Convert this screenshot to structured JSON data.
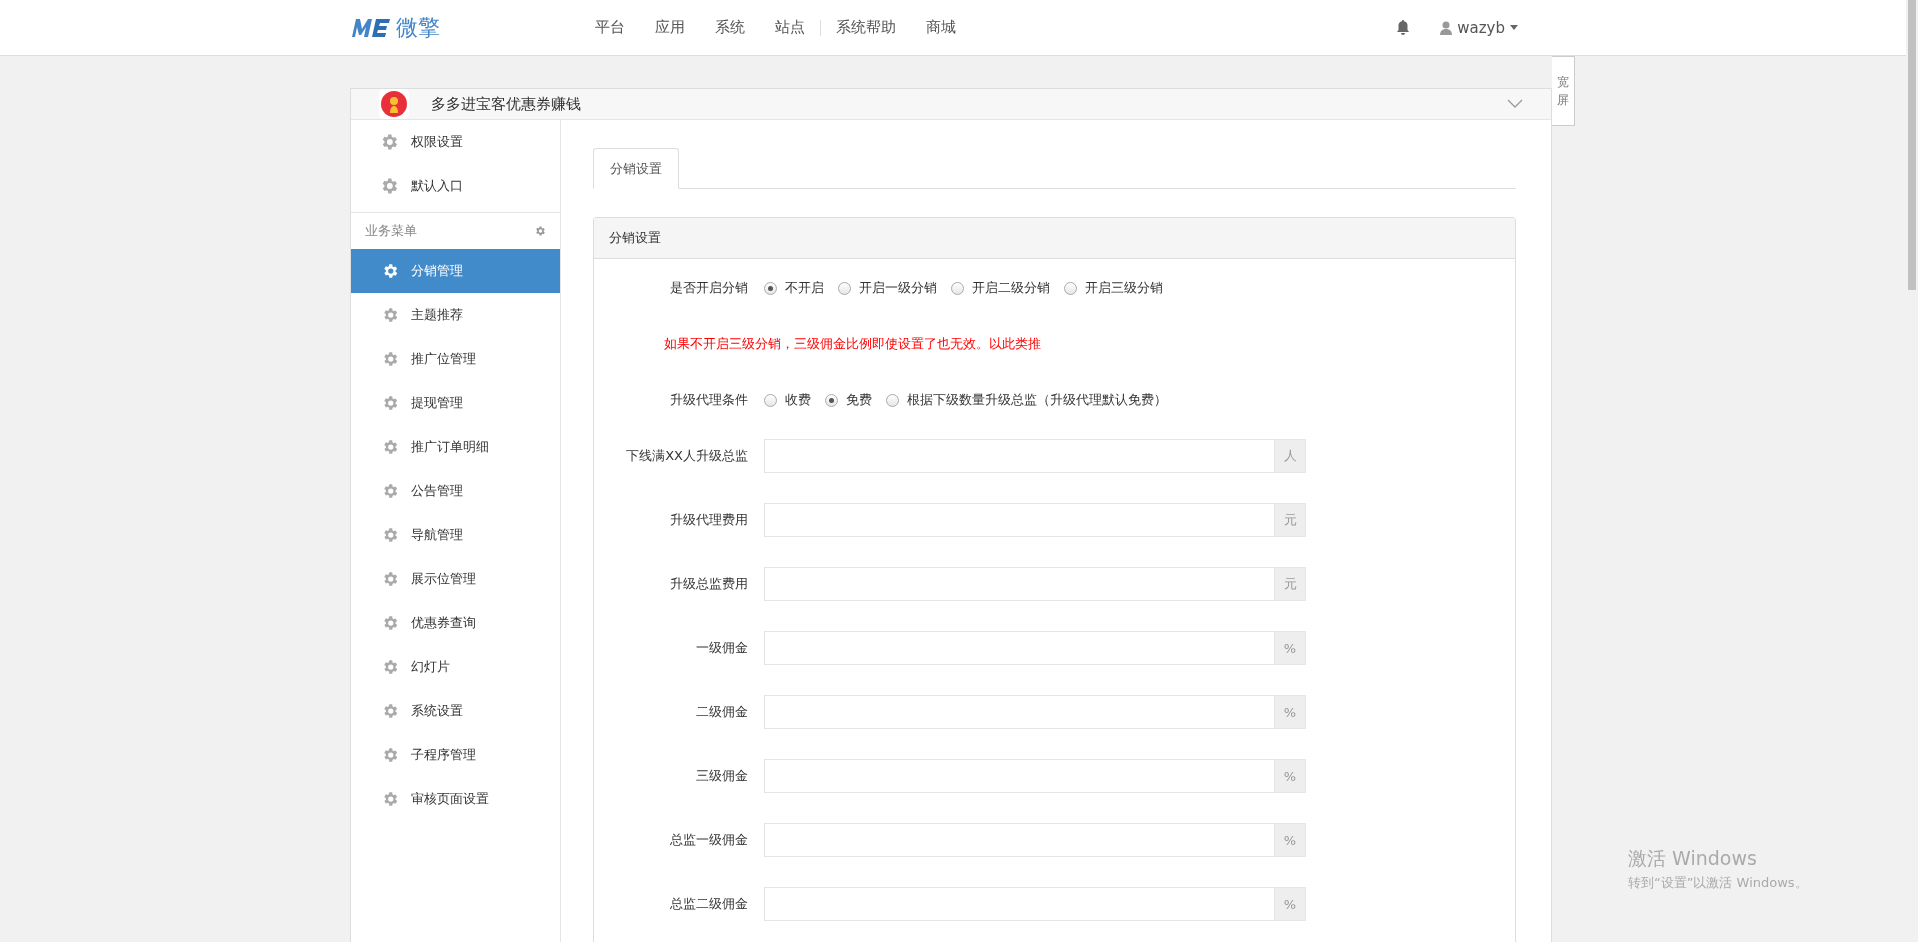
{
  "header": {
    "logo_text": "微擎",
    "nav": [
      {
        "label": "平台"
      },
      {
        "label": "应用"
      },
      {
        "label": "系统"
      },
      {
        "label": "站点"
      },
      {
        "label": "系统帮助",
        "divider_before": true
      },
      {
        "label": "商城"
      }
    ],
    "user": "wazyb"
  },
  "app": {
    "title": "多多进宝客优惠券赚钱"
  },
  "wide_button": "宽屏",
  "sidebar": {
    "top_items": [
      {
        "label": "权限设置"
      },
      {
        "label": "默认入口"
      }
    ],
    "section_title": "业务菜单",
    "items": [
      {
        "label": "分销管理",
        "selected": true
      },
      {
        "label": "主题推荐",
        "selected": false
      },
      {
        "label": "推广位管理",
        "selected": false
      },
      {
        "label": "提现管理",
        "selected": false
      },
      {
        "label": "推广订单明细",
        "selected": false
      },
      {
        "label": "公告管理",
        "selected": false
      },
      {
        "label": "导航管理",
        "selected": false
      },
      {
        "label": "展示位管理",
        "selected": false
      },
      {
        "label": "优惠券查询",
        "selected": false
      },
      {
        "label": "幻灯片",
        "selected": false
      },
      {
        "label": "系统设置",
        "selected": false
      },
      {
        "label": "子程序管理",
        "selected": false
      },
      {
        "label": "审核页面设置",
        "selected": false
      }
    ]
  },
  "tabs": [
    {
      "label": "分销设置",
      "selected": true
    }
  ],
  "panel": {
    "title": "分销设置",
    "rows": [
      {
        "kind": "radio",
        "label": "是否开启分销",
        "options": [
          {
            "label": "不开启",
            "selected": true
          },
          {
            "label": "开启一级分销",
            "selected": false
          },
          {
            "label": "开启二级分销",
            "selected": false
          },
          {
            "label": "开启三级分销",
            "selected": false
          }
        ]
      },
      {
        "kind": "note",
        "text": "如果不开启三级分销，三级佣金比例即使设置了也无效。以此类推"
      },
      {
        "kind": "radio",
        "label": "升级代理条件",
        "options": [
          {
            "label": "收费",
            "selected": false
          },
          {
            "label": "免费",
            "selected": true
          },
          {
            "label": "根据下级数量升级总监（升级代理默认免费）",
            "selected": false
          }
        ]
      },
      {
        "kind": "input",
        "label": "下线满XX人升级总监",
        "addon": "人"
      },
      {
        "kind": "input",
        "label": "升级代理费用",
        "addon": "元"
      },
      {
        "kind": "input",
        "label": "升级总监费用",
        "addon": "元"
      },
      {
        "kind": "input",
        "label": "一级佣金",
        "addon": "%"
      },
      {
        "kind": "input",
        "label": "二级佣金",
        "addon": "%"
      },
      {
        "kind": "input",
        "label": "三级佣金",
        "addon": "%"
      },
      {
        "kind": "input",
        "label": "总监一级佣金",
        "addon": "%"
      },
      {
        "kind": "input",
        "label": "总监二级佣金",
        "addon": "%"
      }
    ]
  },
  "os_notice": {
    "title": "激活 Windows",
    "subtitle": "转到“设置”以激活 Windows。"
  }
}
